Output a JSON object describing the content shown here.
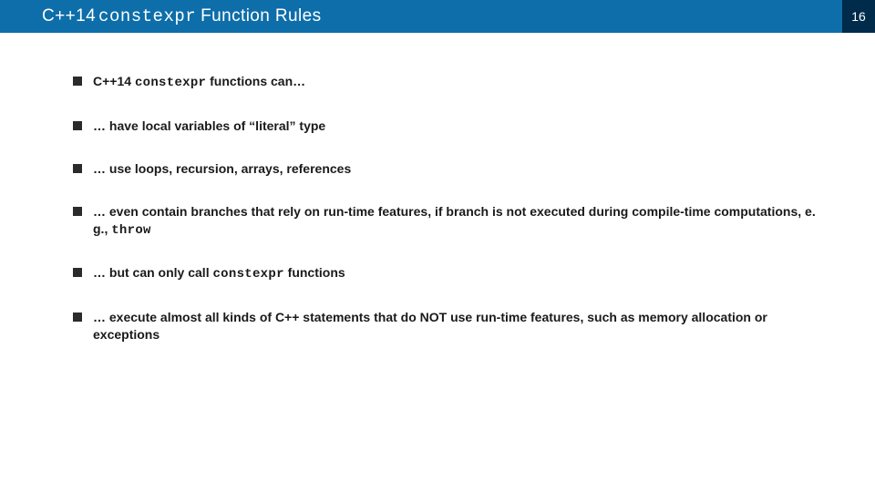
{
  "header": {
    "title_prefix": "C++14",
    "title_code": "constexpr",
    "title_suffix": "Function Rules",
    "page_number": "16"
  },
  "bullets": [
    {
      "type": "mixed",
      "parts": [
        {
          "text": "C++14 ",
          "class": ""
        },
        {
          "text": "constexpr",
          "class": "mono"
        },
        {
          "text": " functions can…",
          "class": ""
        }
      ]
    },
    {
      "type": "plain",
      "text": "… have local variables of “literal” type"
    },
    {
      "type": "plain",
      "text": "… use loops, recursion, arrays, references"
    },
    {
      "type": "mixed",
      "parts": [
        {
          "text": "… even contain branches that rely on run-time features, if branch is not executed during compile-time computations, e. g., ",
          "class": ""
        },
        {
          "text": "throw",
          "class": "mono"
        }
      ]
    },
    {
      "type": "mixed",
      "parts": [
        {
          "text": "… but can only call ",
          "class": ""
        },
        {
          "text": "constexpr",
          "class": "mono"
        },
        {
          "text": " functions",
          "class": ""
        }
      ]
    },
    {
      "type": "plain",
      "text": "… execute almost all kinds of C++ statements that do NOT use run-time features, such as memory allocation or exceptions"
    }
  ]
}
